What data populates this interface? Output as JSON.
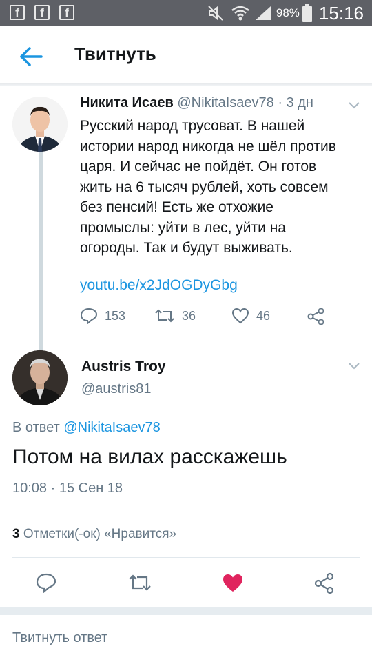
{
  "status_bar": {
    "battery": "98%",
    "time": "15:16",
    "left_icons": [
      "facebook-icon",
      "facebook-icon",
      "facebook-icon"
    ],
    "right_icons": [
      "mute-icon",
      "wifi-icon",
      "signal-icon",
      "battery-icon"
    ]
  },
  "header": {
    "title": "Твитнуть"
  },
  "original_tweet": {
    "name": "Никита Исаев",
    "handle": "@NikitaIsaev78",
    "age": "· 3 дн",
    "text": "Русский народ трусоват. В нашей истории народ никогда не шёл против царя. И сейчас не пойдёт. Он готов жить на 6 тысяч рублей, хоть совсем без пенсий! Есть же отхожие промыслы: уйти в лес, уйти на огороды. Так и будут выживать.",
    "link": "youtu.be/x2JdOGDyGbg",
    "replies": "153",
    "retweets": "36",
    "likes": "46"
  },
  "reply_tweet": {
    "name": "Austris Troy",
    "handle": "@austris81",
    "reply_prefix": "В ответ",
    "reply_mention": "@NikitaIsaev78",
    "text": "Потом на вилах расскажешь",
    "timestamp": "10:08 · 15 Сен 18",
    "likes_count": "3",
    "likes_label": "Отметки(-ок) «Нравится»"
  },
  "reply_box": {
    "placeholder": "Твитнуть ответ"
  },
  "colors": {
    "accent": "#1b95e0",
    "like": "#e0245e",
    "muted": "#657786",
    "statusbar": "#5e6066"
  }
}
